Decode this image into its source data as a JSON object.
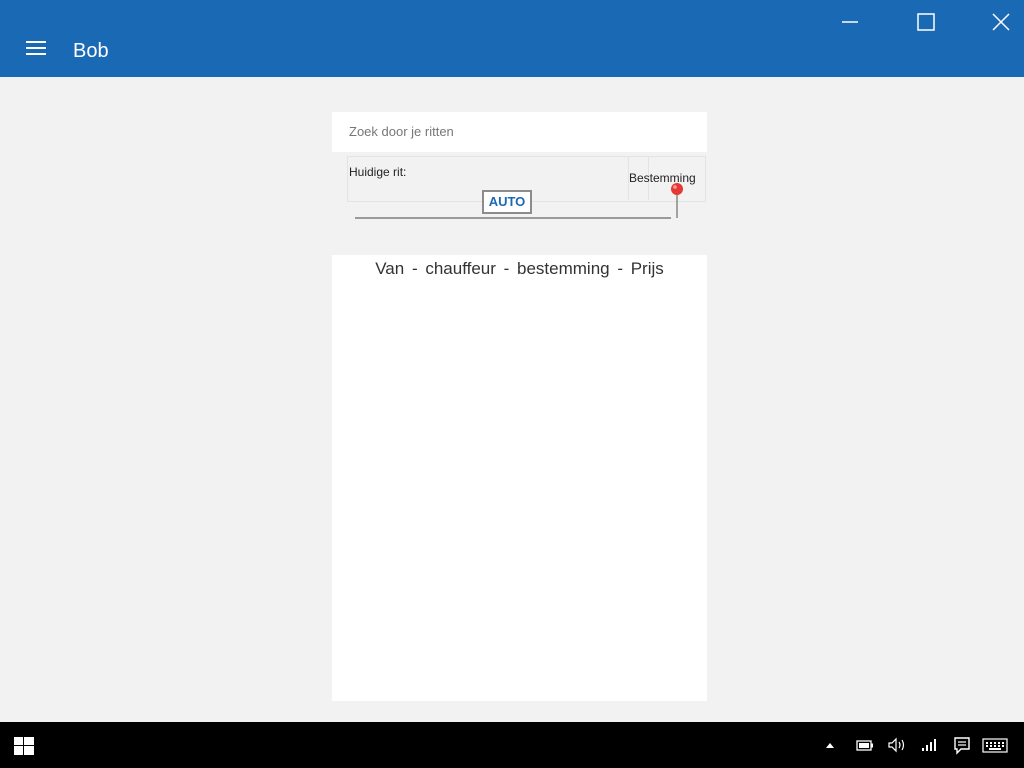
{
  "app": {
    "title": "Bob",
    "colors": {
      "accent": "#1a69b4",
      "background": "#f2f2f2",
      "pin": "#e53935"
    }
  },
  "window_controls": [
    "minimize-icon",
    "maximize-icon",
    "close-icon"
  ],
  "search": {
    "placeholder": "Zoek door je ritten",
    "value": ""
  },
  "current_ride": {
    "label": "Huidige rit:",
    "vehicle_label": "AUTO",
    "destination_label": "Bestemming"
  },
  "ride_list": {
    "header": "Van - chauffeur - bestemming - Prijs",
    "items": []
  },
  "taskbar": {
    "icons": [
      "windows-start-icon",
      "show-hidden-icons-icon",
      "battery-icon",
      "volume-icon",
      "network-icon",
      "action-center-icon",
      "touch-keyboard-icon"
    ]
  }
}
